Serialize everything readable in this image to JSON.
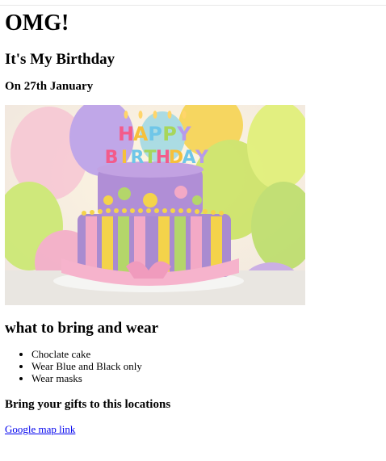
{
  "heading_main": "OMG!",
  "heading_sub": "It's My Birthday",
  "date_line": "On 27th January",
  "image": {
    "cake_letters_top": [
      "H",
      "A",
      "P",
      "P",
      "Y"
    ],
    "cake_letters_bottom": [
      "B",
      "I",
      "R",
      "T",
      "H",
      "D",
      "A",
      "Y"
    ]
  },
  "bring_heading": "what to bring and wear",
  "bring_items": [
    "Choclate cake",
    "Wear Blue and Black only",
    "Wear masks"
  ],
  "gifts_heading": "Bring your gifts to this locations",
  "map_link_text": "Google map link",
  "colors": {
    "link": "#0000ee",
    "cake_purple": "#a98bd0",
    "cake_pink": "#f3a9c6",
    "cake_yellow": "#f4d34a",
    "cake_green": "#b4d66a"
  }
}
